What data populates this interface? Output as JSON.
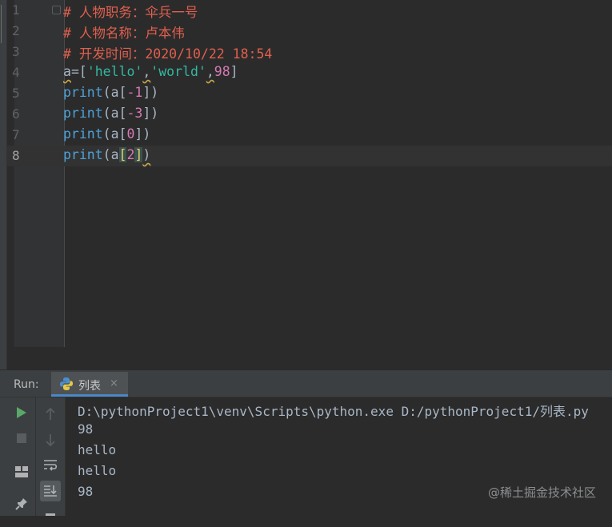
{
  "editor": {
    "lines": [
      {
        "num": "1",
        "tokens": [
          {
            "t": "# 人物职务：伞兵一号",
            "c": "c-comment"
          }
        ]
      },
      {
        "num": "2",
        "tokens": [
          {
            "t": "# 人物名称：卢本伟",
            "c": "c-comment"
          }
        ]
      },
      {
        "num": "3",
        "tokens": [
          {
            "t": "# 开发时间：2020/10/22 18:54",
            "c": "c-comment"
          }
        ]
      },
      {
        "num": "4",
        "tokens": [
          {
            "t": "a",
            "c": "c-var c-warn"
          },
          {
            "t": "=",
            "c": "c-punc"
          },
          {
            "t": "[",
            "c": "c-punc"
          },
          {
            "t": "'hello'",
            "c": "c-str"
          },
          {
            "t": ",",
            "c": "c-punc c-warn"
          },
          {
            "t": "'world'",
            "c": "c-str"
          },
          {
            "t": ",",
            "c": "c-punc c-warn"
          },
          {
            "t": "98",
            "c": "c-num"
          },
          {
            "t": "]",
            "c": "c-punc"
          }
        ]
      },
      {
        "num": "5",
        "tokens": [
          {
            "t": "print",
            "c": "c-fn"
          },
          {
            "t": "(",
            "c": "c-punc"
          },
          {
            "t": "a",
            "c": "c-var"
          },
          {
            "t": "[",
            "c": "c-punc"
          },
          {
            "t": "-1",
            "c": "c-num"
          },
          {
            "t": "]",
            "c": "c-punc"
          },
          {
            "t": ")",
            "c": "c-punc"
          }
        ]
      },
      {
        "num": "6",
        "tokens": [
          {
            "t": "print",
            "c": "c-fn"
          },
          {
            "t": "(",
            "c": "c-punc"
          },
          {
            "t": "a",
            "c": "c-var"
          },
          {
            "t": "[",
            "c": "c-punc"
          },
          {
            "t": "-3",
            "c": "c-num"
          },
          {
            "t": "]",
            "c": "c-punc"
          },
          {
            "t": ")",
            "c": "c-punc"
          }
        ]
      },
      {
        "num": "7",
        "tokens": [
          {
            "t": "print",
            "c": "c-fn"
          },
          {
            "t": "(",
            "c": "c-punc"
          },
          {
            "t": "a",
            "c": "c-var"
          },
          {
            "t": "[",
            "c": "c-punc"
          },
          {
            "t": "0",
            "c": "c-num"
          },
          {
            "t": "]",
            "c": "c-punc"
          },
          {
            "t": ")",
            "c": "c-punc"
          }
        ]
      },
      {
        "num": "8",
        "current": true,
        "tokens": [
          {
            "t": "print",
            "c": "c-fn"
          },
          {
            "t": "(",
            "c": "c-punc"
          },
          {
            "t": "a",
            "c": "c-var"
          },
          {
            "t": "[",
            "c": "c-brkt c-hl"
          },
          {
            "t": "2",
            "c": "c-num"
          },
          {
            "t": "]",
            "c": "c-brkt c-hl"
          },
          {
            "t": ")",
            "c": "c-punc c-warn"
          }
        ]
      }
    ]
  },
  "run_panel": {
    "label": "Run:",
    "tab_label": "列表",
    "close_symbol": "×"
  },
  "console": {
    "lines": [
      "D:\\pythonProject1\\venv\\Scripts\\python.exe D:/pythonProject1/列表.py",
      "98",
      "hello",
      "hello",
      "98"
    ]
  },
  "watermark": "@稀土掘金技术社区",
  "icons": {
    "run": "play-icon",
    "stop": "stop-icon",
    "up": "arrow-up-icon",
    "down": "arrow-down-icon",
    "wrap": "soft-wrap-icon",
    "scroll_end": "scroll-to-end-icon",
    "layout": "layout-icon",
    "pin": "pin-icon",
    "python": "python-icon"
  },
  "colors": {
    "comment": "#e0604f",
    "string": "#34b8a0",
    "number": "#d57ab5",
    "function": "#4fa2d8",
    "run_green": "#59a869"
  }
}
